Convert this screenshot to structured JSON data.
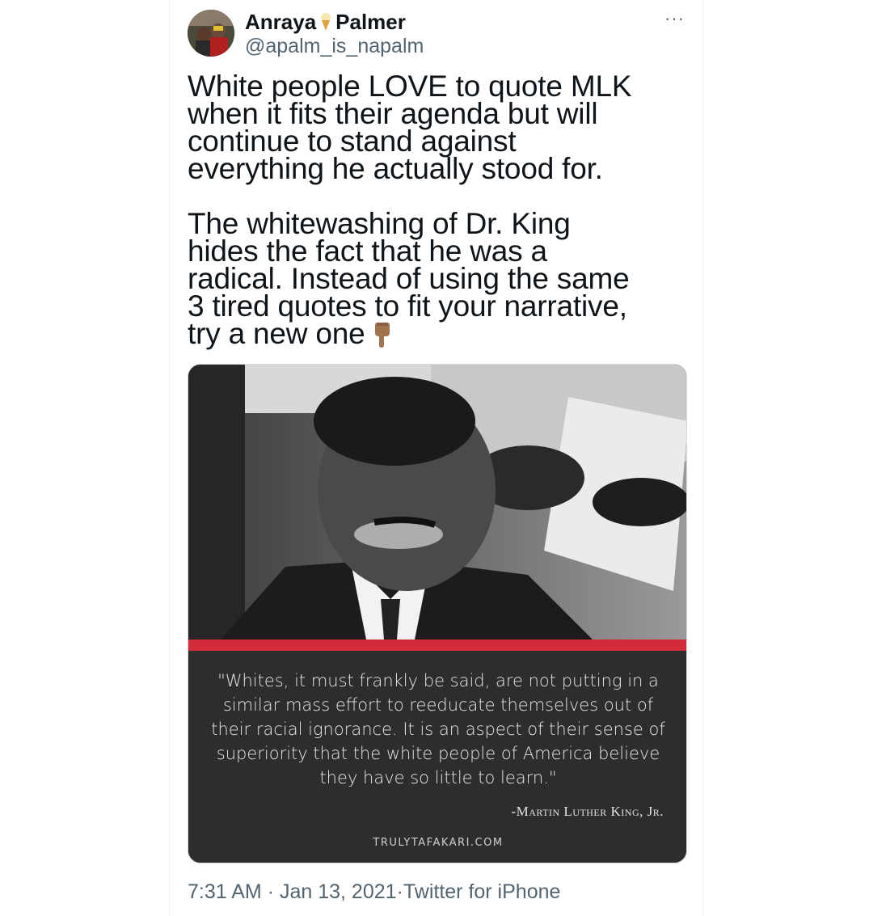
{
  "tweet": {
    "author_first": "Anraya",
    "author_last": "Palmer",
    "author_emoji": "ice-cream-cone",
    "handle": "@apalm_is_napalm",
    "more_label": "···",
    "paragraph1": "White people LOVE to quote MLK\nwhen it fits their agenda but will\ncontinue to stand against\neverything he actually stood for.",
    "paragraph2": "The whitewashing of Dr. King\nhides the fact that he was a\nradical. Instead of using the same\n3 tired quotes to fit your narrative,\ntry a new one",
    "emoji": "backhand-index-pointing-down",
    "time": "7:31 AM",
    "date": "Jan 13, 2021",
    "source": "Twitter for iPhone",
    "separator": "·"
  },
  "media": {
    "quote": "\"Whites, it must frankly be said, are not putting in a similar mass effort to reeducate themselves out of their racial ignorance. It is an aspect of their sense of superiority that the white people of America believe they have so little to learn.\"",
    "attribution": "-Martin Luther King, Jr.",
    "site": "TRULYTAFAKARI.COM",
    "accent_color": "#d42b3a",
    "panel_color": "#2d2d2d"
  }
}
